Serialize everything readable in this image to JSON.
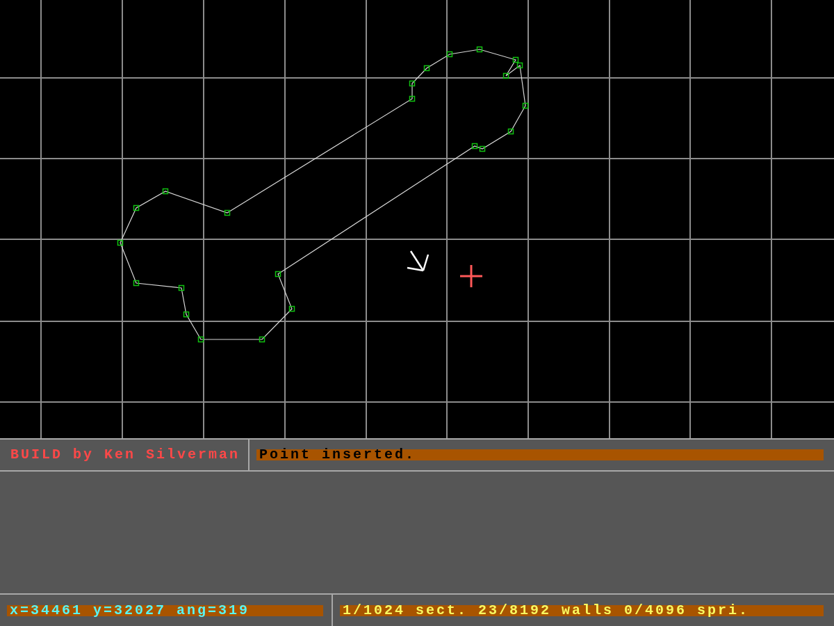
{
  "title": "BUILD by Ken Silverman",
  "message": "Point inserted.",
  "status_bar": {
    "position": "x=34461 y=32027 ang=319",
    "counts": "1/1024 sect. 23/8192 walls 0/4096 spri."
  }
}
